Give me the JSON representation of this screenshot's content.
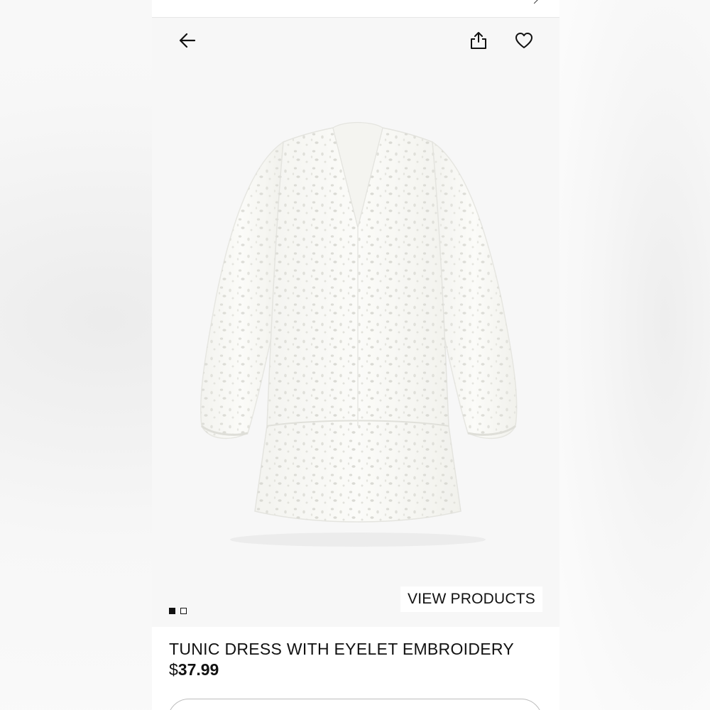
{
  "header": {
    "back_icon": "arrow-left-icon",
    "share_icon": "share-icon",
    "favorite_icon": "heart-icon"
  },
  "product": {
    "title": "TUNIC DRESS WITH EYELET EMBROIDERY",
    "currency": "$",
    "price": "37.99",
    "image_description_icon": "dress-image"
  },
  "gallery": {
    "view_products_label": "VIEW PRODUCTS",
    "total_images": 2,
    "active_index": 0
  },
  "colors": {
    "text": "#111111",
    "background": "#ffffff",
    "image_bg": "#f7f7f7"
  }
}
